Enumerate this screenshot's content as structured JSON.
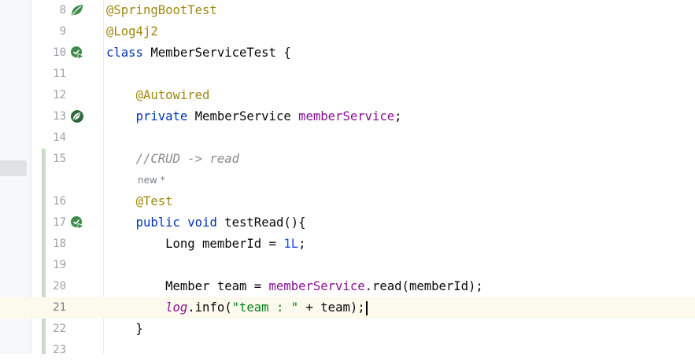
{
  "editor": {
    "lines": {
      "l8": {
        "number": "8",
        "tokens": [
          "@SpringBootTest"
        ]
      },
      "l9": {
        "number": "9",
        "tokens": [
          "@Log4j2"
        ]
      },
      "l10": {
        "number": "10",
        "tokens": [
          "class",
          " MemberServiceTest {"
        ]
      },
      "l11": {
        "number": "11"
      },
      "l12": {
        "number": "12",
        "tokens": [
          "    ",
          "@Autowired"
        ]
      },
      "l13": {
        "number": "13",
        "tokens": [
          "    ",
          "private",
          " MemberService ",
          "memberService",
          ";"
        ]
      },
      "l14": {
        "number": "14"
      },
      "l15": {
        "number": "15",
        "tokens": [
          "    ",
          "//CRUD -> read"
        ]
      },
      "hint": {
        "text": "new *"
      },
      "l16": {
        "number": "16",
        "tokens": [
          "    ",
          "@Test"
        ]
      },
      "l17": {
        "number": "17",
        "tokens": [
          "    ",
          "public",
          " ",
          "void",
          " testRead(){"
        ]
      },
      "l18": {
        "number": "18",
        "tokens": [
          "        Long memberId = ",
          "1L",
          ";"
        ]
      },
      "l19": {
        "number": "19"
      },
      "l20": {
        "number": "20",
        "tokens": [
          "        Member team = ",
          "memberService",
          ".read(memberId);"
        ]
      },
      "l21": {
        "number": "21",
        "tokens": [
          "        ",
          "log",
          ".info(",
          "\"team : \"",
          " + team);"
        ]
      },
      "l22": {
        "number": "22",
        "tokens": [
          "    }"
        ]
      },
      "l23": {
        "number": "23"
      }
    },
    "gutter_icons": {
      "l8": "spring-bean-leaf-icon",
      "l10": "run-test-icon",
      "l13": "spring-autowired-bean-icon",
      "l17": "run-test-icon"
    },
    "current_line": "21",
    "colors": {
      "keyword": "#0033b3",
      "annotation": "#9e880d",
      "field": "#871094",
      "number": "#1750eb",
      "string": "#067d17",
      "comment": "#8c8c8c",
      "current_line_bg": "#fcfaed",
      "spring_green": "#3d8a4a"
    }
  }
}
